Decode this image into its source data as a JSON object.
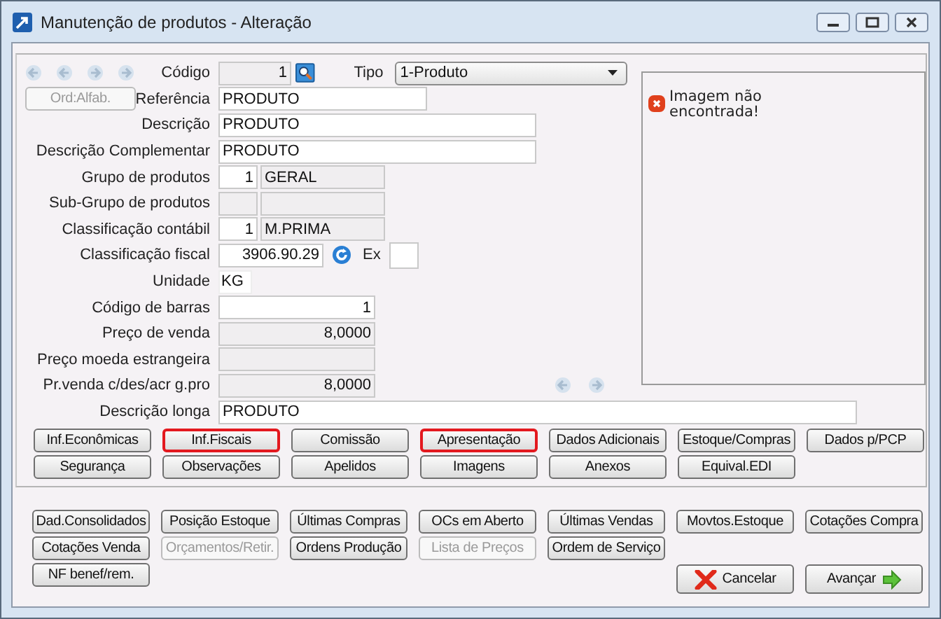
{
  "window": {
    "title": "Manutenção de produtos - Alteração"
  },
  "sort_button": {
    "label": "Ord:Alfab.",
    "disabled": true
  },
  "fields": [
    {
      "kind": "code",
      "label": "Código",
      "inputs": [
        {
          "value": "1",
          "editable": false
        }
      ],
      "type_label": "Tipo",
      "type_value": "1-Produto"
    },
    {
      "kind": "short_text",
      "label": "Referência",
      "inputs": [
        {
          "value": "PRODUTO",
          "editable": true
        }
      ]
    },
    {
      "kind": "text",
      "label": "Descrição",
      "inputs": [
        {
          "value": "PRODUTO",
          "editable": true
        }
      ]
    },
    {
      "kind": "text",
      "label": "Descrição Complementar",
      "inputs": [
        {
          "value": "PRODUTO",
          "editable": true
        }
      ]
    },
    {
      "kind": "lookup",
      "label": "Grupo de produtos",
      "inputs": [
        {
          "value": "1",
          "editable": true
        },
        {
          "value": "GERAL",
          "editable": false
        }
      ]
    },
    {
      "kind": "lookup",
      "label": "Sub-Grupo de produtos",
      "inputs": [
        {
          "editable": false
        },
        {
          "editable": false
        }
      ]
    },
    {
      "kind": "lookup",
      "label": "Classificação contábil",
      "inputs": [
        {
          "value": "1",
          "editable": true
        },
        {
          "value": "M.PRIMA",
          "editable": false
        }
      ]
    },
    {
      "kind": "fiscal",
      "label": "Classificação fiscal",
      "inputs": [
        {
          "value": "3906.90.29",
          "editable": true
        },
        {
          "editable": true
        }
      ],
      "ex_label": "Ex"
    },
    {
      "kind": "unit",
      "label": "Unidade",
      "inputs": [
        {
          "value": "KG",
          "editable": true
        }
      ]
    },
    {
      "kind": "number",
      "label": "Código de barras",
      "inputs": [
        {
          "value": "1",
          "editable": true
        }
      ]
    },
    {
      "kind": "number",
      "label": "Preço de venda",
      "inputs": [
        {
          "value": "8,0000",
          "editable": false
        }
      ]
    },
    {
      "kind": "number",
      "label": "Preço moeda estrangeira",
      "inputs": [
        {
          "editable": false
        }
      ]
    },
    {
      "kind": "number_nav",
      "label": "Pr.venda c/des/acr g.pro",
      "inputs": [
        {
          "value": "8,0000",
          "editable": false
        }
      ]
    },
    {
      "kind": "long_text",
      "label": "Descrição longa",
      "inputs": [
        {
          "value": "PRODUTO",
          "editable": true
        }
      ]
    }
  ],
  "image_panel": {
    "message": "Imagem não encontrada!"
  },
  "section_buttons": [
    {
      "label": "Inf.Econômicas",
      "highlighted": false
    },
    {
      "label": "Inf.Fiscais",
      "highlighted": true
    },
    {
      "label": "Comissão",
      "highlighted": false
    },
    {
      "label": "Apresentação",
      "highlighted": true
    },
    {
      "label": "Dados Adicionais",
      "highlighted": false
    },
    {
      "label": "Estoque/Compras",
      "highlighted": false
    },
    {
      "label": "Dados p/PCP",
      "highlighted": false
    },
    {
      "label": "Segurança",
      "highlighted": false
    },
    {
      "label": "Observações",
      "highlighted": false
    },
    {
      "label": "Apelidos",
      "highlighted": false
    },
    {
      "label": "Imagens",
      "highlighted": false
    },
    {
      "label": "Anexos",
      "highlighted": false
    },
    {
      "label": "Equival.EDI",
      "highlighted": false
    }
  ],
  "query_buttons": [
    [
      {
        "label": "Dad.Consolidados",
        "disabled": false
      },
      {
        "label": "Posição Estoque",
        "disabled": false
      },
      {
        "label": "Últimas Compras",
        "disabled": false
      },
      {
        "label": "OCs em Aberto",
        "disabled": false
      },
      {
        "label": "Últimas Vendas",
        "disabled": false
      },
      {
        "label": "Movtos.Estoque",
        "disabled": false
      },
      {
        "label": "Cotações Compra",
        "disabled": false
      }
    ],
    [
      {
        "label": "Cotações Venda",
        "disabled": false
      },
      {
        "label": "Orçamentos/Retir.",
        "disabled": true
      },
      {
        "label": "Ordens Produção",
        "disabled": false
      },
      {
        "label": "Lista de Preços",
        "disabled": true
      },
      {
        "label": "Ordem de Serviço",
        "disabled": false
      }
    ],
    [
      {
        "label": "NF benef/rem.",
        "disabled": false
      }
    ]
  ],
  "footer_buttons": [
    {
      "kind": "cancel",
      "label": "Cancelar"
    },
    {
      "kind": "next",
      "label": "Avançar"
    }
  ]
}
